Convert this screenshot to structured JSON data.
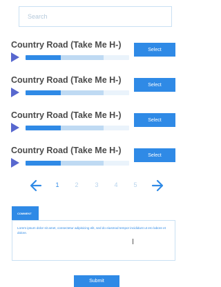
{
  "search": {
    "placeholder": "Search"
  },
  "tracks": [
    {
      "title": "Country Road (Take Me H-)",
      "select_label": "Select",
      "played": 0.34,
      "buffered": 0.75
    },
    {
      "title": "Country Road (Take Me H-)",
      "select_label": "Select",
      "played": 0.34,
      "buffered": 0.75
    },
    {
      "title": "Country Road (Take Me H-)",
      "select_label": "Select",
      "played": 0.34,
      "buffered": 0.75
    },
    {
      "title": "Country Road (Take Me H-)",
      "select_label": "Select",
      "played": 0.34,
      "buffered": 0.75
    }
  ],
  "pagination": {
    "pages": [
      "1",
      "2",
      "3",
      "4",
      "5"
    ],
    "current": "1",
    "prev_icon": "arrow-left-icon",
    "next_icon": "arrow-right-icon"
  },
  "comment": {
    "tab_label": "COMMENT",
    "text": "Lorem ipsum dolor sit amet, consectetur adipisicing elit, sed do eiusmod tempor incididunt ut ero labore et dolore."
  },
  "submit_label": "Submit",
  "colors": {
    "accent": "#2f8ae6",
    "play": "#5868cf",
    "buffered": "#bfdaf3",
    "track_bg": "#eaf3fb",
    "border": "#c9e0f3"
  }
}
